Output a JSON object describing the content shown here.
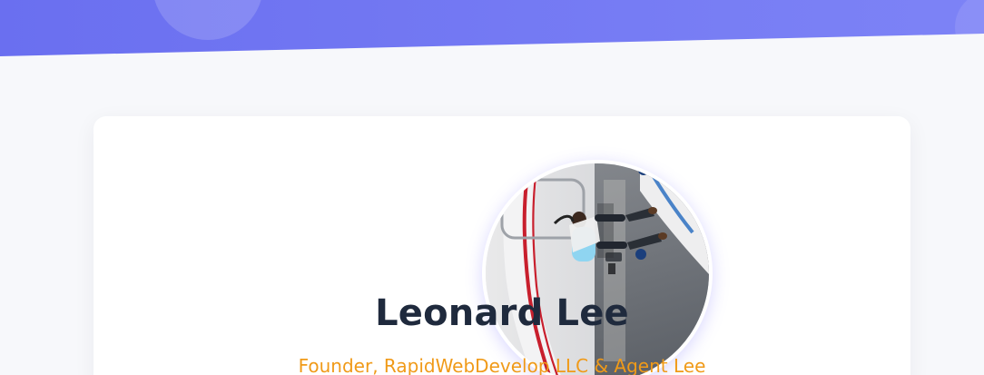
{
  "profile": {
    "name": "Leonard Lee",
    "title": "Founder, RapidWebDevelop LLC & Agent Lee",
    "avatar_icon": "profile-photo"
  },
  "theme": {
    "banner_color": "#6a6ff0",
    "name_color": "#1f2a3d",
    "title_color": "#f09a18"
  }
}
